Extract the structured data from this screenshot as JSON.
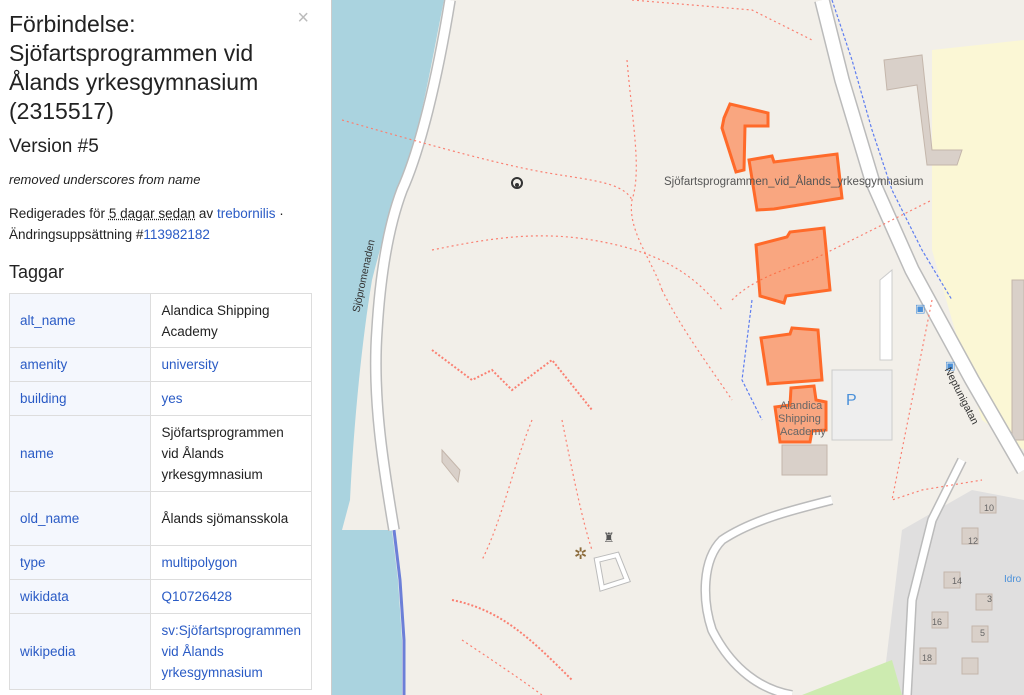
{
  "sidebar": {
    "close": "×",
    "title": "Förbindelse: Sjöfartsprogrammen vid Ålands yrkesgymnasium (2315517)",
    "version": "Version #5",
    "comment": "removed underscores from name",
    "edited_prefix": "Redigerades för",
    "edited_time": "5 dagar sedan",
    "edited_by": "av",
    "user": "trebornilis",
    "separator": "·",
    "changeset_label": "Ändringsuppsättning #",
    "changeset_id": "113982182",
    "tags_title": "Taggar",
    "tags": [
      {
        "key": "alt_name",
        "value": "Alandica Shipping Academy",
        "link": false
      },
      {
        "key": "amenity",
        "value": "university",
        "link": true
      },
      {
        "key": "building",
        "value": "yes",
        "link": true
      },
      {
        "key": "name",
        "value": "Sjöfartsprogrammen vid Ålands yrkesgymnasium",
        "link": false
      },
      {
        "key": "old_name",
        "value": "Ålands sjömansskola",
        "link": false
      },
      {
        "key": "type",
        "value": "multipolygon",
        "link": true
      },
      {
        "key": "wikidata",
        "value": "Q10726428",
        "link": true
      },
      {
        "key": "wikipedia",
        "value": "sv:Sjöfartsprogrammen vid Ålands yrkesgymnasium",
        "link": true
      }
    ]
  },
  "map": {
    "feature_label": "Sjöfartsprogrammen_vid_Ålands_yrkesgymnasium",
    "academy_label_1": "Alandica",
    "academy_label_2": "Shipping",
    "academy_label_3": "Academy",
    "street_1": "Sjöpromenaden",
    "street_2": "Neptunigatan",
    "parking": "P",
    "numbers": [
      "10",
      "12",
      "14",
      "16",
      "18",
      "3",
      "5"
    ],
    "idro": "Idro",
    "colors": {
      "land": "#f2efe9",
      "water": "#aad3df",
      "highlight": "#ff6a2a",
      "building": "#d9d0c9",
      "residential": "#e0dfdf"
    }
  }
}
